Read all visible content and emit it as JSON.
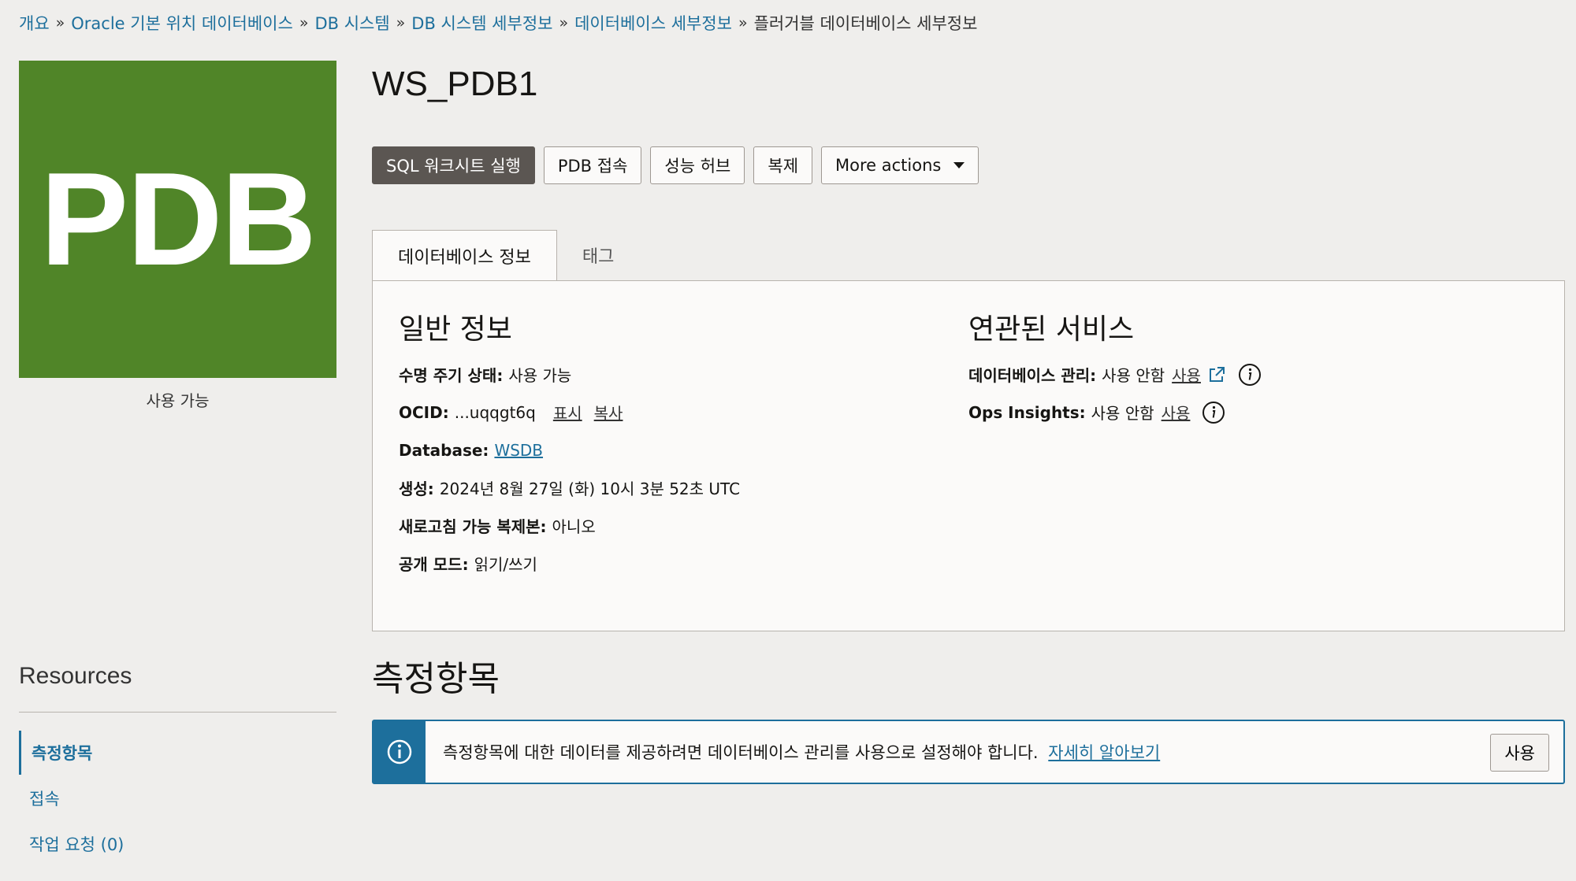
{
  "breadcrumb": [
    {
      "label": "개요"
    },
    {
      "label": "Oracle 기본 위치 데이터베이스"
    },
    {
      "label": "DB 시스템"
    },
    {
      "label": "DB 시스템 세부정보"
    },
    {
      "label": "데이터베이스 세부정보"
    }
  ],
  "breadcrumb_separator": "»",
  "breadcrumb_current": "플러거블 데이터베이스 세부정보",
  "tile": {
    "text": "PDB",
    "status": "사용 가능",
    "color": "#508528"
  },
  "title": "WS_PDB1",
  "actions": {
    "sql_worksheet": "SQL 워크시트 실행",
    "pdb_connect": "PDB 접속",
    "perf_hub": "성능 허브",
    "clone": "복제",
    "more": "More actions"
  },
  "tabs": {
    "db_info": "데이터베이스 정보",
    "tags": "태그"
  },
  "general": {
    "heading": "일반 정보",
    "lifecycle_label": "수명 주기 상태:",
    "lifecycle_value": "사용 가능",
    "ocid_label": "OCID:",
    "ocid_value": "...uqqgt6q",
    "ocid_show": "표시",
    "ocid_copy": "복사",
    "database_label": "Database:",
    "database_value": "WSDB",
    "created_label": "생성:",
    "created_value": "2024년 8월 27일 (화) 10시 3분 52초 UTC",
    "refreshable_label": "새로고침 가능 복제본:",
    "refreshable_value": "아니오",
    "open_mode_label": "공개 모드:",
    "open_mode_value": "읽기/쓰기"
  },
  "services": {
    "heading": "연관된 서비스",
    "dbm_label": "데이터베이스 관리:",
    "dbm_value": "사용 안함",
    "dbm_link": "사용",
    "ops_label": "Ops Insights:",
    "ops_value": "사용 안함",
    "ops_link": "사용"
  },
  "metrics": {
    "heading": "측정항목",
    "banner_text": "측정항목에 대한 데이터를 제공하려면 데이터베이스 관리를 사용으로 설정해야 합니다.",
    "banner_link": "자세히 알아보기",
    "banner_button": "사용"
  },
  "resources": {
    "heading": "Resources",
    "items": [
      {
        "label": "측정항목"
      },
      {
        "label": "접속"
      },
      {
        "label": "작업 요청 (0)"
      }
    ]
  },
  "colors": {
    "accent": "#1d6f9c",
    "primary_button": "#5b5652",
    "background": "#efeeec"
  }
}
